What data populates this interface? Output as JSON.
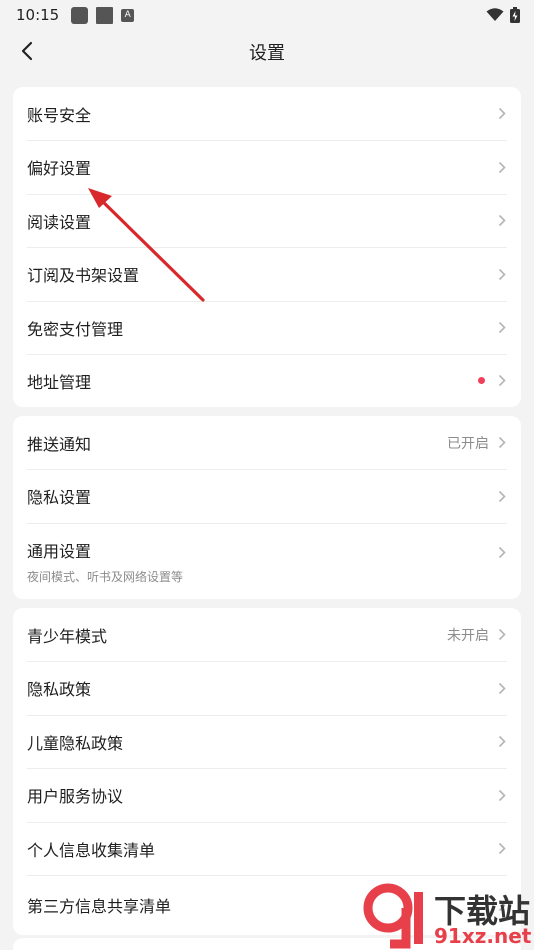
{
  "status_bar": {
    "time": "10:15"
  },
  "header": {
    "title": "设置"
  },
  "groups": [
    {
      "items": [
        {
          "label": "账号安全"
        },
        {
          "label": "偏好设置"
        },
        {
          "label": "阅读设置"
        },
        {
          "label": "订阅及书架设置"
        },
        {
          "label": "免密支付管理"
        },
        {
          "label": "地址管理",
          "has_dot": true
        }
      ]
    },
    {
      "items": [
        {
          "label": "推送通知",
          "value": "已开启"
        },
        {
          "label": "隐私设置"
        },
        {
          "label": "通用设置",
          "sub": "夜间模式、听书及网络设置等"
        }
      ]
    },
    {
      "items": [
        {
          "label": "青少年模式",
          "value": "未开启"
        },
        {
          "label": "隐私政策"
        },
        {
          "label": "儿童隐私政策"
        },
        {
          "label": "用户服务协议"
        },
        {
          "label": "个人信息收集清单"
        },
        {
          "label": "第三方信息共享清单"
        }
      ]
    }
  ],
  "watermark": {
    "brand": "下载站",
    "url": "91xz.net"
  },
  "colors": {
    "annotation_arrow": "#d8282c",
    "notify_dot": "#f0405a",
    "background": "#f3f3f3"
  },
  "icons": [
    "back-arrow-icon",
    "chevron-right-icon",
    "wifi-icon",
    "battery-icon"
  ]
}
